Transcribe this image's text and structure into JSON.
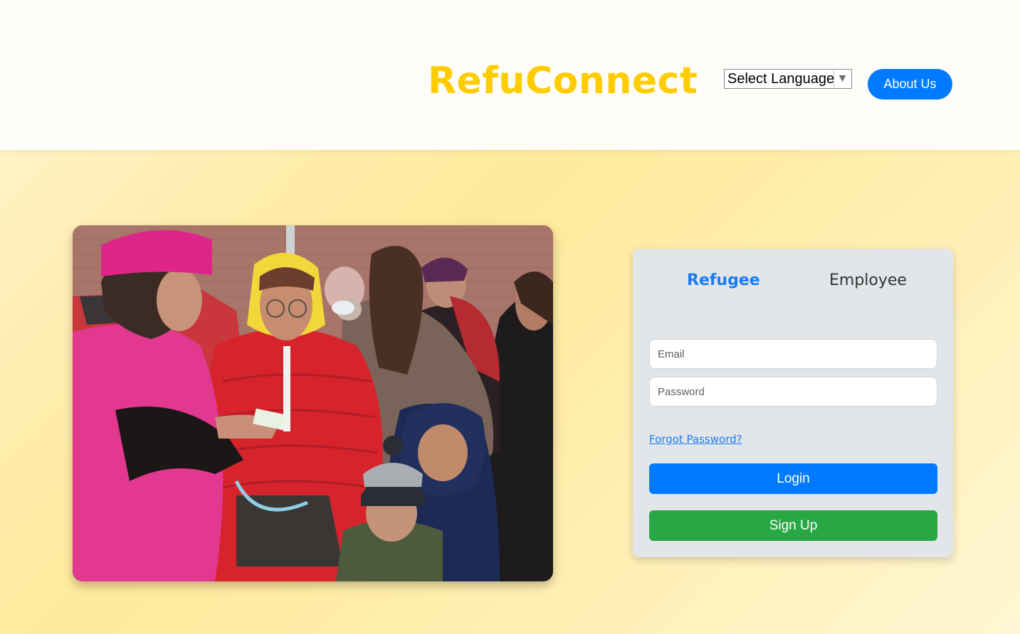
{
  "header": {
    "brand": "RefuConnect",
    "language_select": {
      "label": "Select Language",
      "arrow": "▼"
    },
    "about_label": "About Us"
  },
  "auth": {
    "tabs": [
      {
        "label": "Refugee",
        "active": true
      },
      {
        "label": "Employee",
        "active": false
      }
    ],
    "email_placeholder": "Email",
    "password_placeholder": "Password",
    "forgot_label": "Forgot Password?",
    "login_label": "Login",
    "signup_label": "Sign Up"
  },
  "colors": {
    "brand": "#ffcc00",
    "primary": "#007bff",
    "success": "#28a745",
    "card_bg": "#e2e6e8",
    "header_bg": "#fffdf9"
  }
}
